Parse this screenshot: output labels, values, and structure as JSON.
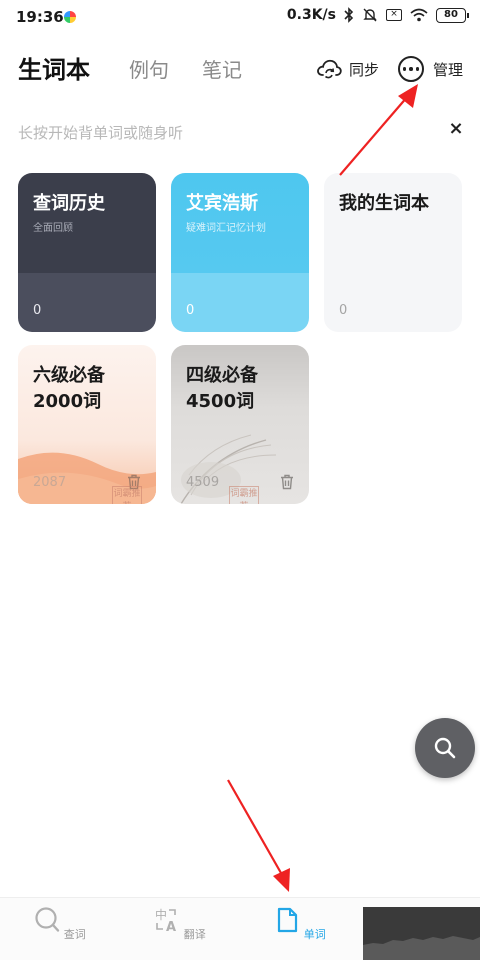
{
  "status_bar": {
    "time": "19:36",
    "network_speed": "0.3K/s",
    "sim_icon_text": "×",
    "battery": "80"
  },
  "header": {
    "tabs": [
      {
        "label": "生词本",
        "active": true
      },
      {
        "label": "例句",
        "active": false
      },
      {
        "label": "笔记",
        "active": false
      }
    ],
    "sync_label": "同步",
    "manage_label": "管理"
  },
  "tip": {
    "text": "长按开始背单词或随身听",
    "close": "×"
  },
  "cards": {
    "history": {
      "title": "查词历史",
      "subtitle": "全面回顾",
      "count": "0"
    },
    "ebbinghaus": {
      "title": "艾宾浩斯",
      "subtitle": "疑难词汇记忆计划",
      "count": "0"
    },
    "mine": {
      "title": "我的生词本",
      "count": "0"
    },
    "cet6": {
      "title_line1": "六级必备",
      "title_line2": "2000词",
      "count": "2087",
      "stamp": "词霸推荐"
    },
    "cet4": {
      "title_line1": "四级必备",
      "title_line2": "4500词",
      "count": "4509",
      "stamp": "词霸推荐"
    }
  },
  "bottom_nav": {
    "items": [
      {
        "label": "查词",
        "icon": "search-icon",
        "active": false
      },
      {
        "label": "翻译",
        "icon": "translate-icon",
        "active": false
      },
      {
        "label": "单词",
        "icon": "document-icon",
        "active": true
      }
    ]
  },
  "colors": {
    "accent": "#23a6e6",
    "annotation_arrow": "#ee2222",
    "history_card": "#3b3e4b",
    "ebbinghaus_card": "#56c9f0",
    "mine_card": "#f5f6f8"
  }
}
